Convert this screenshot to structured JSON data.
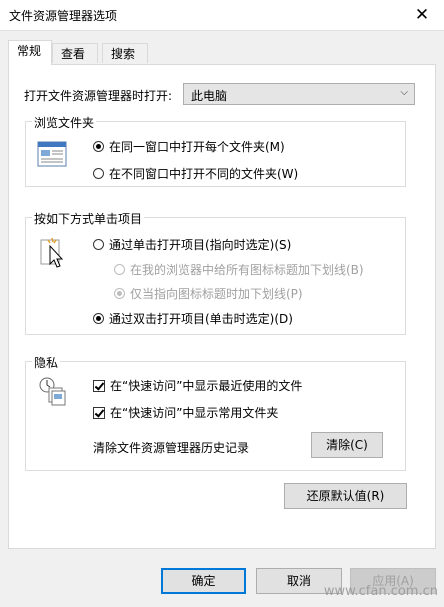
{
  "window": {
    "title": "文件资源管理器选项",
    "close_glyph": "✕"
  },
  "tabs": [
    {
      "label": "常规",
      "active": true
    },
    {
      "label": "查看",
      "active": false
    },
    {
      "label": "搜索",
      "active": false
    }
  ],
  "open_to": {
    "label": "打开文件资源管理器时打开:",
    "value": "此电脑"
  },
  "browse_folders": {
    "title": "浏览文件夹",
    "options": [
      {
        "label": "在同一窗口中打开每个文件夹(M)",
        "selected": true
      },
      {
        "label": "在不同窗口中打开不同的文件夹(W)",
        "selected": false
      }
    ]
  },
  "click_items": {
    "title": "按如下方式单击项目",
    "single_click": {
      "label": "通过单击打开项目(指向时选定)(S)",
      "selected": false
    },
    "underline_all": {
      "label": "在我的浏览器中给所有图标标题加下划线(B)",
      "selected": false,
      "disabled": true
    },
    "underline_point": {
      "label": "仅当指向图标标题时加下划线(P)",
      "selected": true,
      "disabled": true
    },
    "double_click": {
      "label": "通过双击打开项目(单击时选定)(D)",
      "selected": true
    }
  },
  "privacy": {
    "title": "隐私",
    "show_recent": {
      "label": "在“快速访问”中显示最近使用的文件",
      "checked": true
    },
    "show_frequent": {
      "label": "在“快速访问”中显示常用文件夹",
      "checked": true
    },
    "clear_label": "清除文件资源管理器历史记录",
    "clear_button": "清除(C)"
  },
  "restore_defaults": "还原默认值(R)",
  "footer": {
    "ok": "确定",
    "cancel": "取消",
    "apply": "应用(A)"
  },
  "watermark": "www.cfan.com.cn",
  "colors": {
    "accent": "#0078d7",
    "disabled_text": "#a0a0a0"
  }
}
